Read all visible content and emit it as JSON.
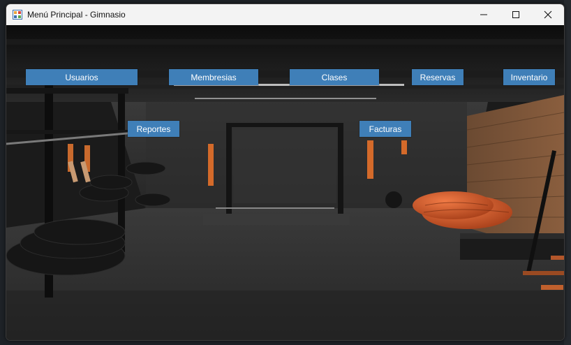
{
  "window": {
    "title": "Menú Principal - Gimnasio",
    "controls": [
      "minimize-icon",
      "maximize-icon",
      "close-icon"
    ]
  },
  "menu": {
    "usuarios": "Usuarios",
    "membresias": "Membresias",
    "clases": "Clases",
    "reservas": "Reservas",
    "inventario": "Inventario",
    "reportes": "Reportes",
    "facturas": "Facturas"
  },
  "colors": {
    "button_bg": "#3f7fb8",
    "button_text": "#ffffff",
    "titlebar_bg": "#f3f3f3"
  },
  "background_image": "gym-interior"
}
